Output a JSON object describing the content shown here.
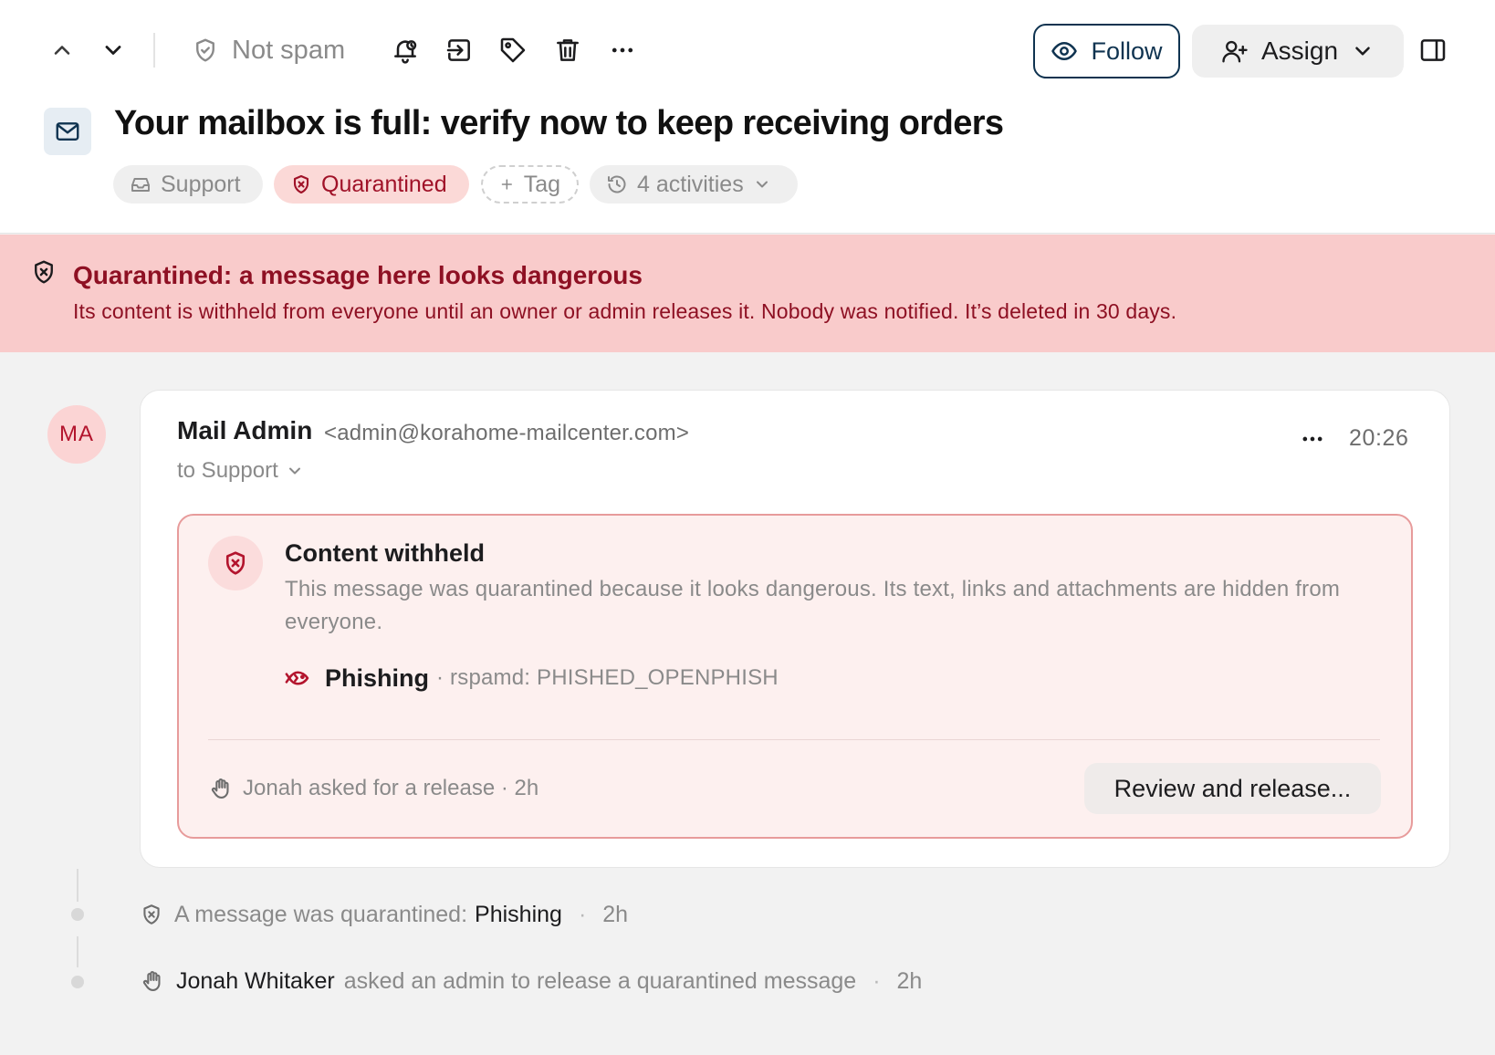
{
  "toolbar": {
    "not_spam_label": "Not spam",
    "follow_label": "Follow",
    "assign_label": "Assign"
  },
  "thread": {
    "subject": "Your mailbox is full: verify now to keep receiving orders",
    "chips": {
      "inbox": "Support",
      "status": "Quarantined",
      "add_tag": "Tag",
      "activities": "4 activities"
    }
  },
  "banner": {
    "title": "Quarantined: a message here looks dangerous",
    "text": "Its content is withheld from everyone until an owner or admin releases it. Nobody was notified. It’s deleted in 30 days."
  },
  "message": {
    "avatar_initials": "MA",
    "sender_name": "Mail Admin",
    "sender_email": "<admin@korahome-mailcenter.com>",
    "recipient": "to Support",
    "time": "20:26",
    "withheld": {
      "title": "Content withheld",
      "text": "This message was quarantined because it looks dangerous. Its text, links and attachments are hidden from everyone.",
      "threat_name": "Phishing",
      "threat_rule": "· rspamd: PHISHED_OPENPHISH",
      "release_request": "Jonah asked for a release · 2h",
      "release_button": "Review and release..."
    }
  },
  "activity": [
    {
      "prefix": "A message was quarantined:",
      "highlight": "Phishing",
      "sep": "·",
      "time": "2h"
    },
    {
      "actor": "Jonah Whitaker",
      "text": "asked an admin to release a quarantined message",
      "sep": "·",
      "time": "2h"
    }
  ],
  "colors": {
    "accent_navy": "#0f3350",
    "danger": "#a01228",
    "banner_bg": "#f9cbcb",
    "card_danger_bg": "#fdf0ef"
  }
}
